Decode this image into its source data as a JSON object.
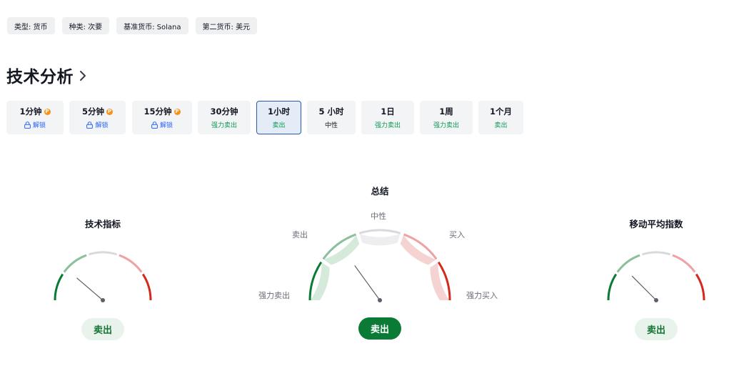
{
  "tags": [
    {
      "label": "类型: 货币"
    },
    {
      "label": "种类: 次要"
    },
    {
      "label": "基准货币: Solana"
    },
    {
      "label": "第二货币: 美元"
    }
  ],
  "section_title": "技术分析",
  "timeframes": [
    {
      "name": "1分钟",
      "status": "解锁",
      "premium": true,
      "locked": true,
      "status_kind": "lock",
      "active": false
    },
    {
      "name": "5分钟",
      "status": "解锁",
      "premium": true,
      "locked": true,
      "status_kind": "lock",
      "active": false
    },
    {
      "name": "15分钟",
      "status": "解锁",
      "premium": true,
      "locked": true,
      "status_kind": "lock",
      "active": false
    },
    {
      "name": "30分钟",
      "status": "强力卖出",
      "premium": false,
      "locked": false,
      "status_kind": "strong-sell",
      "active": false
    },
    {
      "name": "1小时",
      "status": "卖出",
      "premium": false,
      "locked": false,
      "status_kind": "sell",
      "active": true
    },
    {
      "name": "5 小时",
      "status": "中性",
      "premium": false,
      "locked": false,
      "status_kind": "neutral",
      "active": false
    },
    {
      "name": "1日",
      "status": "强力卖出",
      "premium": false,
      "locked": false,
      "status_kind": "strong-sell",
      "active": false
    },
    {
      "name": "1周",
      "status": "强力卖出",
      "premium": false,
      "locked": false,
      "status_kind": "strong-sell",
      "active": false
    },
    {
      "name": "1个月",
      "status": "卖出",
      "premium": false,
      "locked": false,
      "status_kind": "sell",
      "active": false
    }
  ],
  "premium_badge": "P",
  "gauges": {
    "oscillators": {
      "title": "技术指标",
      "rating": "卖出",
      "needle_value": -0.55
    },
    "summary": {
      "title": "总结",
      "rating": "卖出",
      "needle_value": -0.4,
      "scale_labels": {
        "strong_sell": "强力卖出",
        "sell": "卖出",
        "neutral": "中性",
        "buy": "买入",
        "strong_buy": "强力买入"
      }
    },
    "moving_averages": {
      "title": "移动平均指数",
      "rating": "卖出",
      "needle_value": -0.5
    }
  },
  "colors": {
    "strong_sell": "#0a7a34",
    "sell": "#8dbf9c",
    "neutral": "#d8d9dc",
    "buy": "#eda3a3",
    "strong_buy": "#d3281c",
    "sell_fill": "#d5eadb",
    "neutral_fill": "#eeeef0",
    "buy_fill": "#f6d3d3",
    "needle": "#5d606b",
    "accent_blue": "#2b5aab",
    "premium_orange": "#f7931a"
  }
}
